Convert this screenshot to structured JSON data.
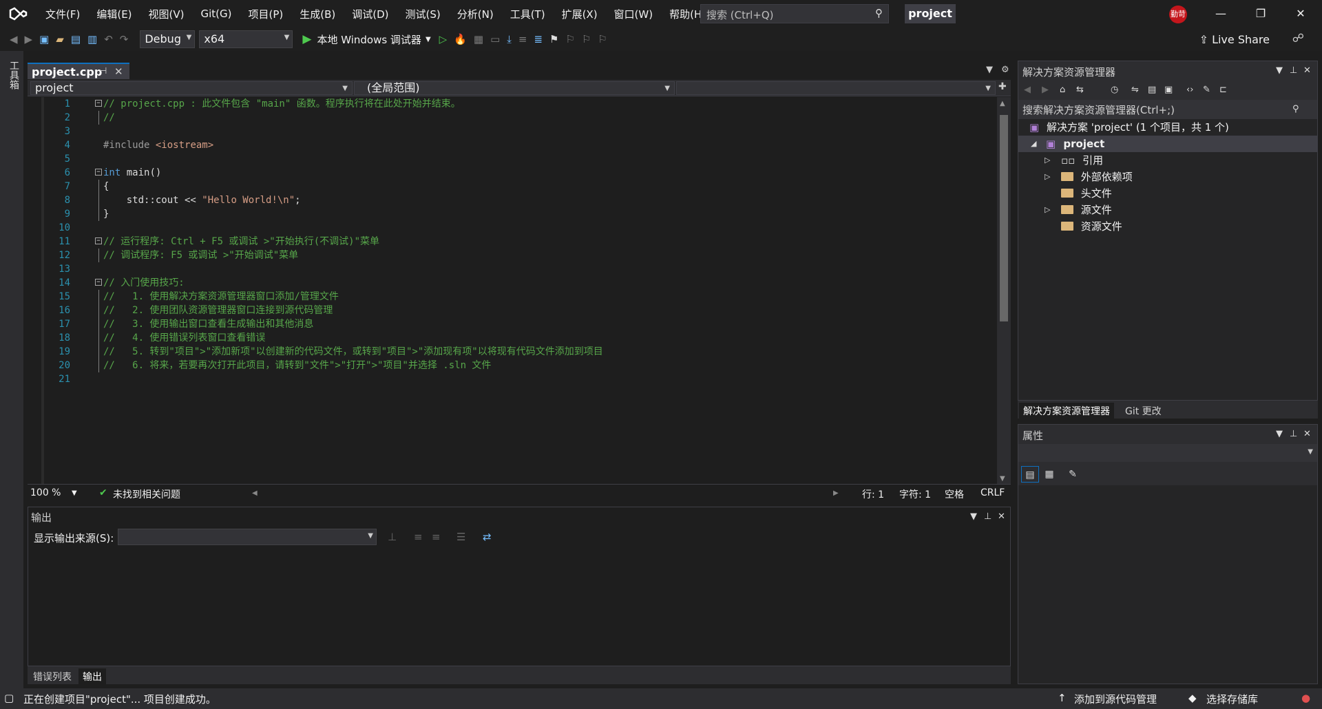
{
  "menus": [
    "文件(F)",
    "编辑(E)",
    "视图(V)",
    "Git(G)",
    "项目(P)",
    "生成(B)",
    "调试(D)",
    "测试(S)",
    "分析(N)",
    "工具(T)",
    "扩展(X)",
    "窗口(W)",
    "帮助(H)"
  ],
  "search_placeholder": "搜索 (Ctrl+Q)",
  "project_title": "project",
  "avatar_text": "勤苛",
  "toolbar": {
    "config": "Debug",
    "platform": "x64",
    "run_label": "本地 Windows 调试器",
    "live_share": "Live Share"
  },
  "toolbox_label": "工具箱",
  "doc_tab": "project.cpp",
  "nav": {
    "project": "project",
    "scope": "(全局范围)"
  },
  "code_lines": [
    {
      "n": "1",
      "fold": "−",
      "text": "// project.cpp : 此文件包含 \"main\" 函数。程序执行将在此处开始并结束。"
    },
    {
      "n": "2",
      "text": "//"
    },
    {
      "n": "3",
      "text": ""
    },
    {
      "n": "4",
      "text": "#include <iostream>"
    },
    {
      "n": "5",
      "text": ""
    },
    {
      "n": "6",
      "fold": "−",
      "text": "int main()"
    },
    {
      "n": "7",
      "text": "{"
    },
    {
      "n": "8",
      "text": "    std::cout << \"Hello World!\\n\";"
    },
    {
      "n": "9",
      "text": "}"
    },
    {
      "n": "10",
      "text": ""
    },
    {
      "n": "11",
      "fold": "−",
      "text": "// 运行程序: Ctrl + F5 或调试 >\"开始执行(不调试)\"菜单"
    },
    {
      "n": "12",
      "text": "// 调试程序: F5 或调试 >\"开始调试\"菜单"
    },
    {
      "n": "13",
      "text": ""
    },
    {
      "n": "14",
      "fold": "−",
      "text": "// 入门使用技巧:"
    },
    {
      "n": "15",
      "text": "//   1. 使用解决方案资源管理器窗口添加/管理文件"
    },
    {
      "n": "16",
      "text": "//   2. 使用团队资源管理器窗口连接到源代码管理"
    },
    {
      "n": "17",
      "text": "//   3. 使用输出窗口查看生成输出和其他消息"
    },
    {
      "n": "18",
      "text": "//   4. 使用错误列表窗口查看错误"
    },
    {
      "n": "19",
      "text": "//   5. 转到\"项目\">\"添加新项\"以创建新的代码文件，或转到\"项目\">\"添加现有项\"以将现有代码文件添加到项目"
    },
    {
      "n": "20",
      "text": "//   6. 将来，若要再次打开此项目，请转到\"文件\">\"打开\">\"项目\"并选择 .sln 文件"
    },
    {
      "n": "21",
      "text": ""
    }
  ],
  "editor_status": {
    "zoom": "100 %",
    "issues": "未找到相关问题",
    "line": "行: 1",
    "col": "字符: 1",
    "spaces": "空格",
    "eol": "CRLF"
  },
  "output": {
    "title": "输出",
    "source_label": "显示输出来源(S):"
  },
  "bottom_tabs": [
    "错误列表",
    "输出"
  ],
  "solution_explorer": {
    "title": "解决方案资源管理器",
    "search": "搜索解决方案资源管理器(Ctrl+;)",
    "solution": "解决方案 'project' (1 个项目，共 1 个)",
    "project": "project",
    "nodes": [
      "引用",
      "外部依赖项",
      "头文件",
      "源文件",
      "资源文件"
    ]
  },
  "se_tabs": [
    "解决方案资源管理器",
    "Git 更改"
  ],
  "properties": {
    "title": "属性"
  },
  "statusbar": {
    "message": "正在创建项目\"project\"... 项目创建成功。",
    "source_control": "添加到源代码管理",
    "repo": "选择存储库"
  },
  "colors": {
    "accent": "#0e70c0",
    "comment": "#57a64a",
    "keyword": "#569cd6",
    "string": "#d69d85"
  }
}
